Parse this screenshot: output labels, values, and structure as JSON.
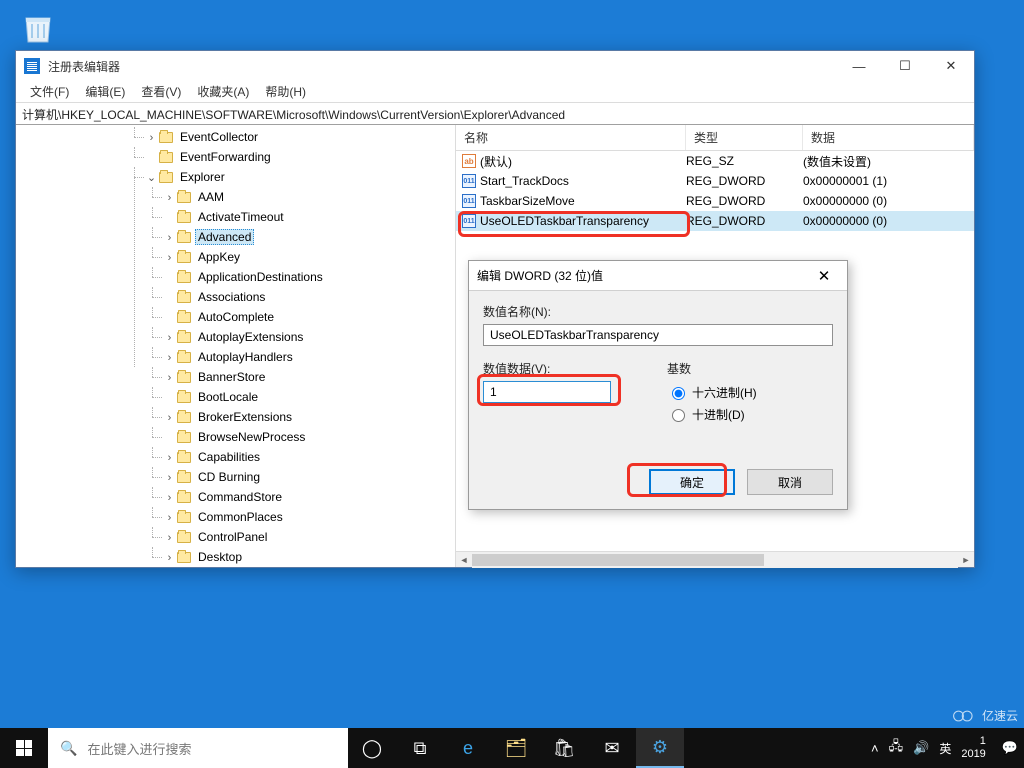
{
  "desktop": {
    "recycle_label": ""
  },
  "window": {
    "title": "注册表编辑器",
    "menus": {
      "file": "文件(F)",
      "edit": "编辑(E)",
      "view": "查看(V)",
      "fav": "收藏夹(A)",
      "help": "帮助(H)"
    },
    "address": "计算机\\HKEY_LOCAL_MACHINE\\SOFTWARE\\Microsoft\\Windows\\CurrentVersion\\Explorer\\Advanced"
  },
  "tree": {
    "items": [
      {
        "label": "EventCollector",
        "exp": ">"
      },
      {
        "label": "EventForwarding",
        "exp": ""
      },
      {
        "label": "Explorer",
        "exp": "v",
        "children": [
          {
            "label": "AAM",
            "exp": ">"
          },
          {
            "label": "ActivateTimeout",
            "exp": ""
          },
          {
            "label": "Advanced",
            "exp": ">",
            "selected": true
          },
          {
            "label": "AppKey",
            "exp": ">"
          },
          {
            "label": "ApplicationDestinations",
            "exp": ""
          },
          {
            "label": "Associations",
            "exp": ""
          },
          {
            "label": "AutoComplete",
            "exp": ""
          },
          {
            "label": "AutoplayExtensions",
            "exp": ">"
          },
          {
            "label": "AutoplayHandlers",
            "exp": ">"
          },
          {
            "label": "BannerStore",
            "exp": ">"
          },
          {
            "label": "BootLocale",
            "exp": ""
          },
          {
            "label": "BrokerExtensions",
            "exp": ">"
          },
          {
            "label": "BrowseNewProcess",
            "exp": ""
          },
          {
            "label": "Capabilities",
            "exp": ">"
          },
          {
            "label": "CD Burning",
            "exp": ">"
          },
          {
            "label": "CommandStore",
            "exp": ">"
          },
          {
            "label": "CommonPlaces",
            "exp": ">"
          },
          {
            "label": "ControlPanel",
            "exp": ">"
          },
          {
            "label": "Desktop",
            "exp": ">"
          }
        ]
      }
    ]
  },
  "values": {
    "headers": {
      "name": "名称",
      "type": "类型",
      "data": "数据"
    },
    "rows": [
      {
        "icon": "ab",
        "name": "(默认)",
        "type": "REG_SZ",
        "data": "(数值未设置)"
      },
      {
        "icon": "bin",
        "name": "Start_TrackDocs",
        "type": "REG_DWORD",
        "data": "0x00000001 (1)"
      },
      {
        "icon": "bin",
        "name": "TaskbarSizeMove",
        "type": "REG_DWORD",
        "data": "0x00000000 (0)"
      },
      {
        "icon": "bin",
        "name": "UseOLEDTaskbarTransparency",
        "type": "REG_DWORD",
        "data": "0x00000000 (0)",
        "selected": true
      }
    ]
  },
  "dialog": {
    "title": "编辑 DWORD (32 位)值",
    "name_label": "数值名称(N):",
    "name_value": "UseOLEDTaskbarTransparency",
    "data_label": "数值数据(V):",
    "data_value": "1",
    "base_label": "基数",
    "hex_label": "十六进制(H)",
    "dec_label": "十进制(D)",
    "ok": "确定",
    "cancel": "取消"
  },
  "taskbar": {
    "search_placeholder": "在此键入进行搜索",
    "ime": "英",
    "clock_time": "1",
    "clock_date": "2019"
  },
  "watermark": "亿速云"
}
